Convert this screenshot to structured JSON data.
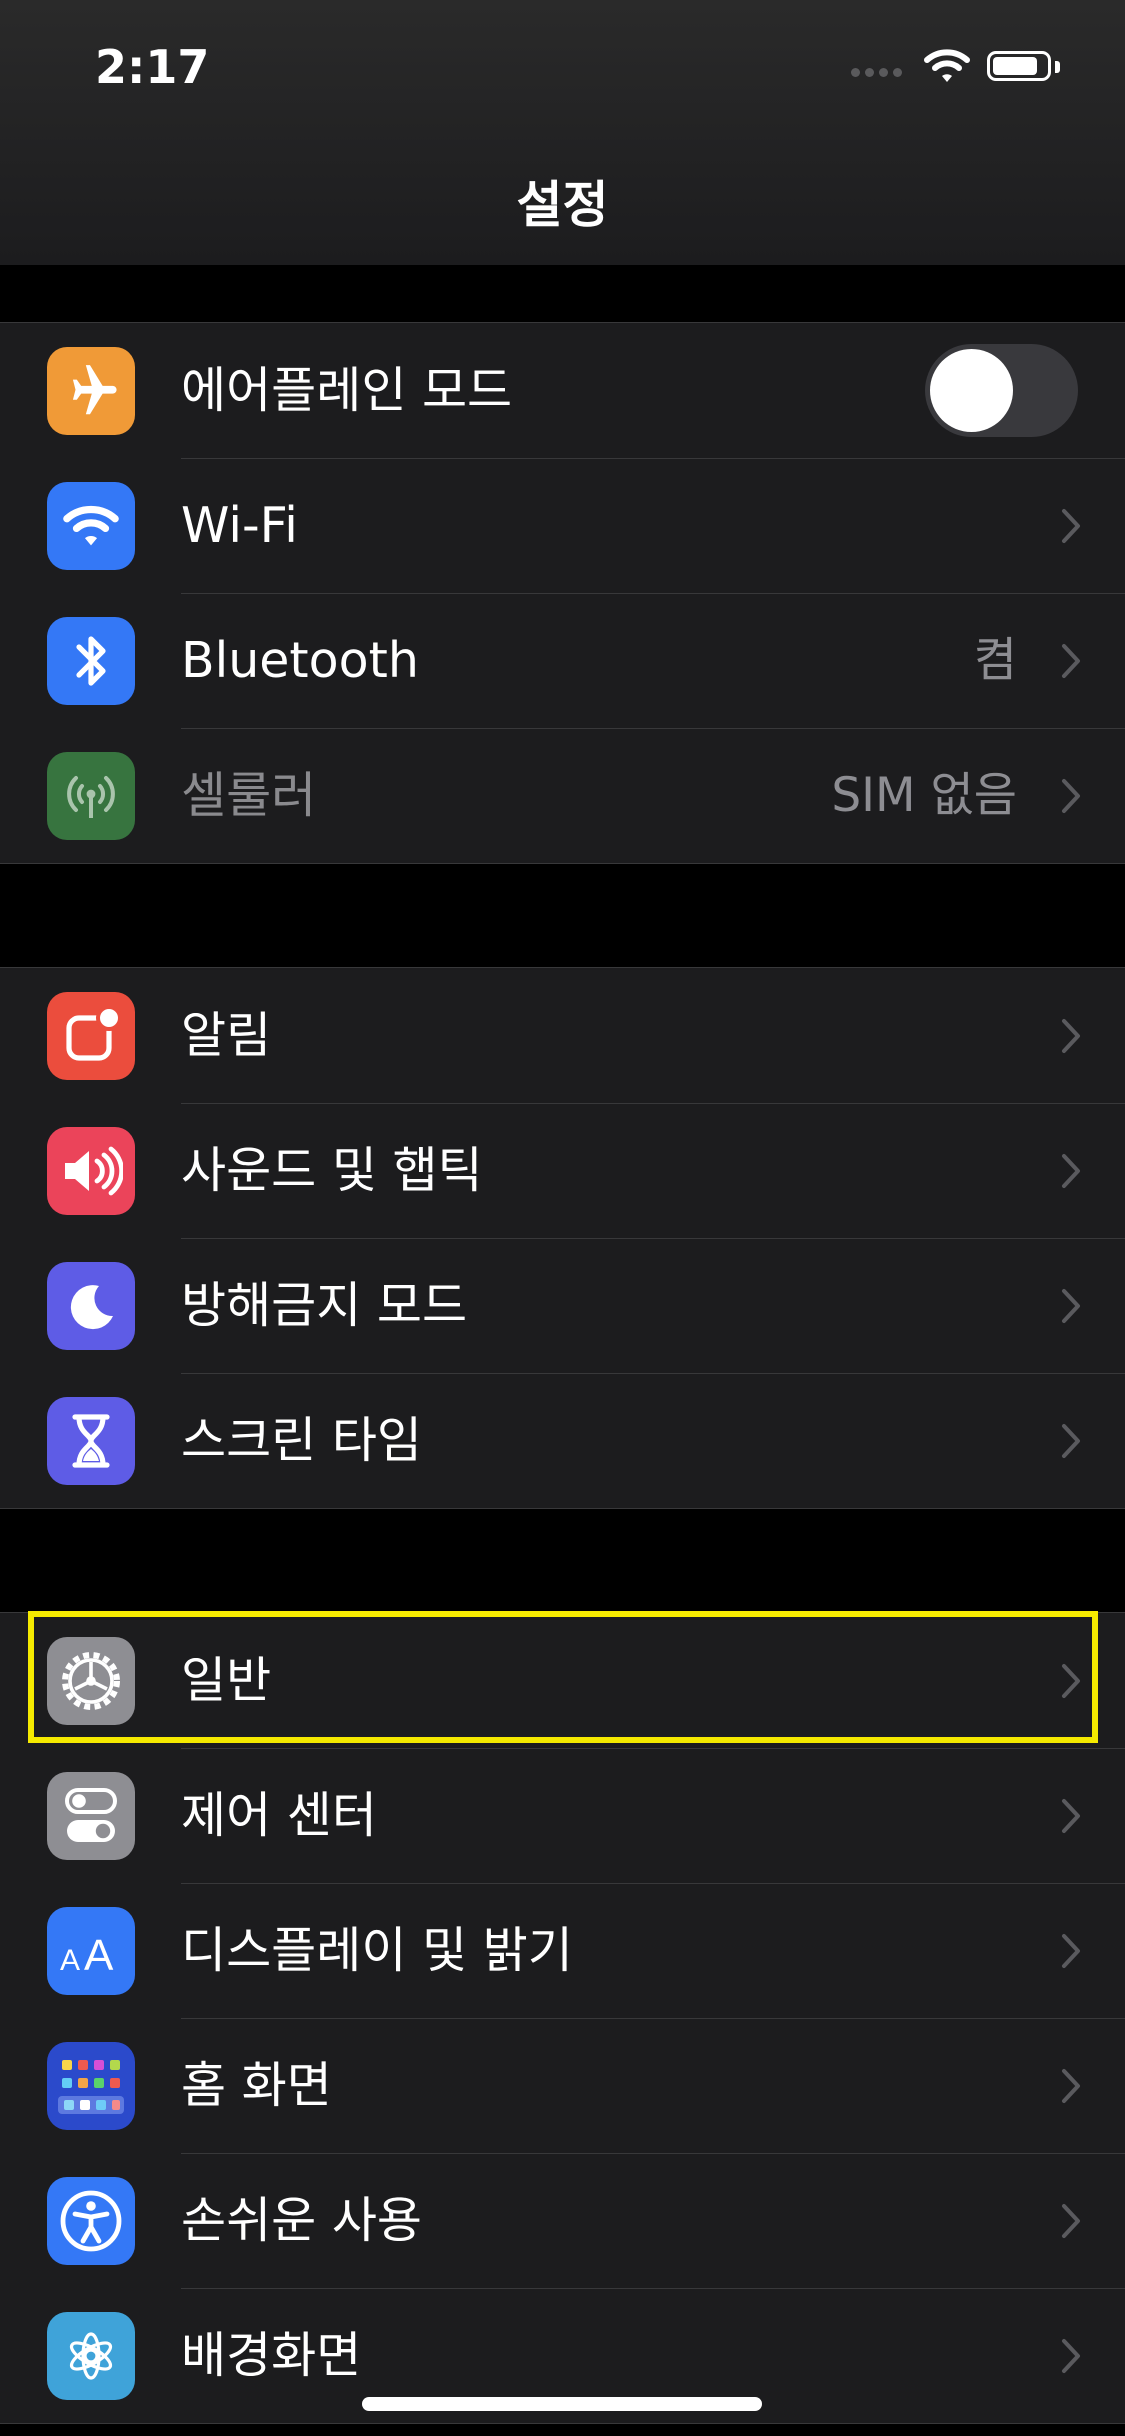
{
  "status_bar": {
    "time": "2:17",
    "battery_level": 0.85,
    "icons": [
      "cellular-dots-icon",
      "wifi-icon",
      "battery-icon"
    ]
  },
  "navigation": {
    "title": "설정"
  },
  "colors": {
    "background": "#000000",
    "cell": "#1c1c1e",
    "separator": "#38383a",
    "secondary_text": "#8d8d92",
    "highlight_border": "#f5ea00",
    "toggle_off": "#39393d"
  },
  "groups": [
    {
      "items": [
        {
          "label": "에어플레인 모드",
          "icon": "airplane-icon",
          "icon_color": "#f09a37",
          "accessory": "toggle",
          "toggle_on": false
        },
        {
          "label": "Wi-Fi",
          "icon": "wifi-icon",
          "icon_color": "#3478f6",
          "accessory": "chevron"
        },
        {
          "label": "Bluetooth",
          "icon": "bluetooth-icon",
          "icon_color": "#3478f6",
          "value": "켬",
          "accessory": "chevron"
        },
        {
          "label": "셀룰러",
          "icon": "cellular-icon",
          "icon_color": "#37743f",
          "value": "SIM 없음",
          "accessory": "chevron",
          "disabled": true
        }
      ]
    },
    {
      "items": [
        {
          "label": "알림",
          "icon": "notifications-icon",
          "icon_color": "#eb4d3d",
          "accessory": "chevron"
        },
        {
          "label": "사운드 및 햅틱",
          "icon": "sound-icon",
          "icon_color": "#eb445a",
          "accessory": "chevron"
        },
        {
          "label": "방해금지 모드",
          "icon": "moon-icon",
          "icon_color": "#5e5ce6",
          "accessory": "chevron"
        },
        {
          "label": "스크린 타임",
          "icon": "hourglass-icon",
          "icon_color": "#5e5ce6",
          "accessory": "chevron"
        }
      ]
    },
    {
      "items": [
        {
          "label": "일반",
          "icon": "gear-icon",
          "icon_color": "#8e8e93",
          "accessory": "chevron",
          "highlighted": true
        },
        {
          "label": "제어 센터",
          "icon": "control-center-icon",
          "icon_color": "#8e8e93",
          "accessory": "chevron"
        },
        {
          "label": "디스플레이 및 밝기",
          "icon": "display-brightness-icon",
          "icon_color": "#3478f6",
          "accessory": "chevron"
        },
        {
          "label": "홈 화면",
          "icon": "home-screen-icon",
          "icon_color": "#2b4acb",
          "accessory": "chevron"
        },
        {
          "label": "손쉬운 사용",
          "icon": "accessibility-icon",
          "icon_color": "#3478f6",
          "accessory": "chevron"
        },
        {
          "label": "배경화면",
          "icon": "wallpaper-icon",
          "icon_color": "#3fa3d9",
          "accessory": "chevron"
        }
      ]
    }
  ]
}
